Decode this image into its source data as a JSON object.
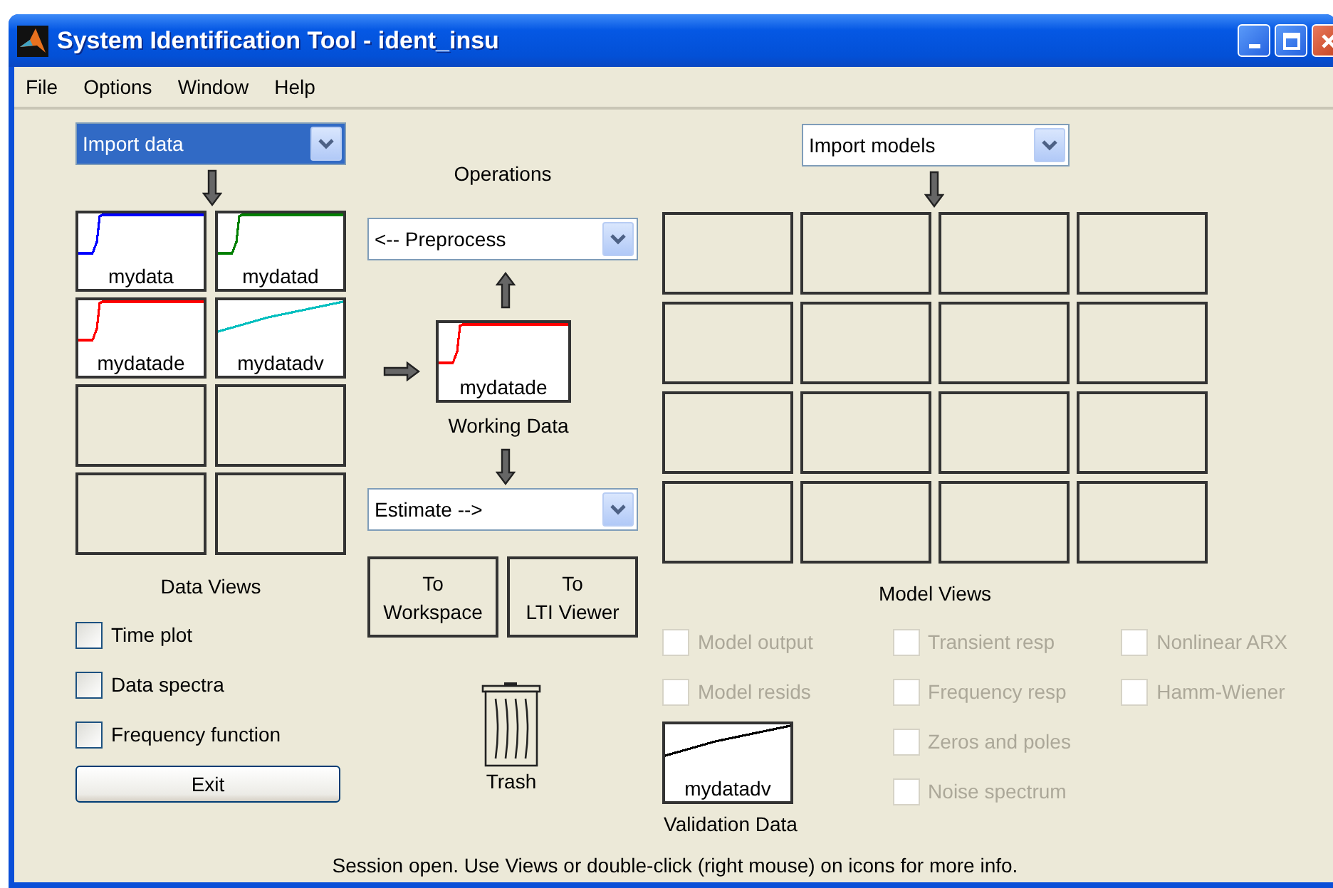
{
  "window": {
    "title": "System Identification Tool - ident_insu"
  },
  "menu": [
    "File",
    "Options",
    "Window",
    "Help"
  ],
  "data_import": {
    "value": "Import data",
    "highlighted": true
  },
  "data_tiles": [
    {
      "kind": "step",
      "label": "mydata",
      "color": "#0000ff"
    },
    {
      "kind": "step",
      "label": "mydatad",
      "color": "#008000"
    },
    {
      "kind": "step",
      "label": "mydatade",
      "color": "#ff0000"
    },
    {
      "kind": "ramp",
      "label": "mydatadv",
      "color": "#00bfbf"
    },
    {
      "kind": "empty"
    },
    {
      "kind": "empty"
    },
    {
      "kind": "empty"
    },
    {
      "kind": "empty"
    }
  ],
  "data_views": {
    "title": "Data Views",
    "items": [
      {
        "label": "Time plot",
        "checked": false,
        "disabled": false
      },
      {
        "label": "Data spectra",
        "checked": false,
        "disabled": false
      },
      {
        "label": "Frequency function",
        "checked": false,
        "disabled": false
      }
    ]
  },
  "exit_button": "Exit",
  "operations": {
    "title": "Operations",
    "preprocess": {
      "value": "<-- Preprocess",
      "highlighted": false
    },
    "working_data": {
      "kind": "step",
      "label": "mydatade",
      "color": "#ff0000"
    },
    "working_label": "Working Data",
    "estimate": {
      "value": "Estimate -->",
      "highlighted": false
    },
    "buttons": [
      "To\nWorkspace",
      "To\nLTI Viewer"
    ],
    "trash_label": "Trash"
  },
  "model_import": {
    "value": "Import models",
    "highlighted": false
  },
  "model_tiles": [
    {
      "kind": "empty"
    },
    {
      "kind": "empty"
    },
    {
      "kind": "empty"
    },
    {
      "kind": "empty"
    },
    {
      "kind": "empty"
    },
    {
      "kind": "empty"
    },
    {
      "kind": "empty"
    },
    {
      "kind": "empty"
    },
    {
      "kind": "empty"
    },
    {
      "kind": "empty"
    },
    {
      "kind": "empty"
    },
    {
      "kind": "empty"
    },
    {
      "kind": "empty"
    },
    {
      "kind": "empty"
    },
    {
      "kind": "empty"
    },
    {
      "kind": "empty"
    }
  ],
  "model_views": {
    "title": "Model Views",
    "columns": [
      [
        {
          "label": "Model output",
          "checked": false,
          "disabled": true
        },
        {
          "label": "Model resids",
          "checked": false,
          "disabled": true
        }
      ],
      [
        {
          "label": "Transient resp",
          "checked": false,
          "disabled": true
        },
        {
          "label": "Frequency resp",
          "checked": false,
          "disabled": true
        },
        {
          "label": "Zeros and poles",
          "checked": false,
          "disabled": true
        },
        {
          "label": "Noise spectrum",
          "checked": false,
          "disabled": true
        }
      ],
      [
        {
          "label": "Nonlinear ARX",
          "checked": false,
          "disabled": true
        },
        {
          "label": "Hamm-Wiener",
          "checked": false,
          "disabled": true
        }
      ]
    ]
  },
  "validation": {
    "tile": {
      "kind": "ramp",
      "label": "mydatadv",
      "color": "#000000"
    },
    "label": "Validation Data"
  },
  "status_bar": "Session open. Use Views or double-click (right mouse) on icons for more info."
}
